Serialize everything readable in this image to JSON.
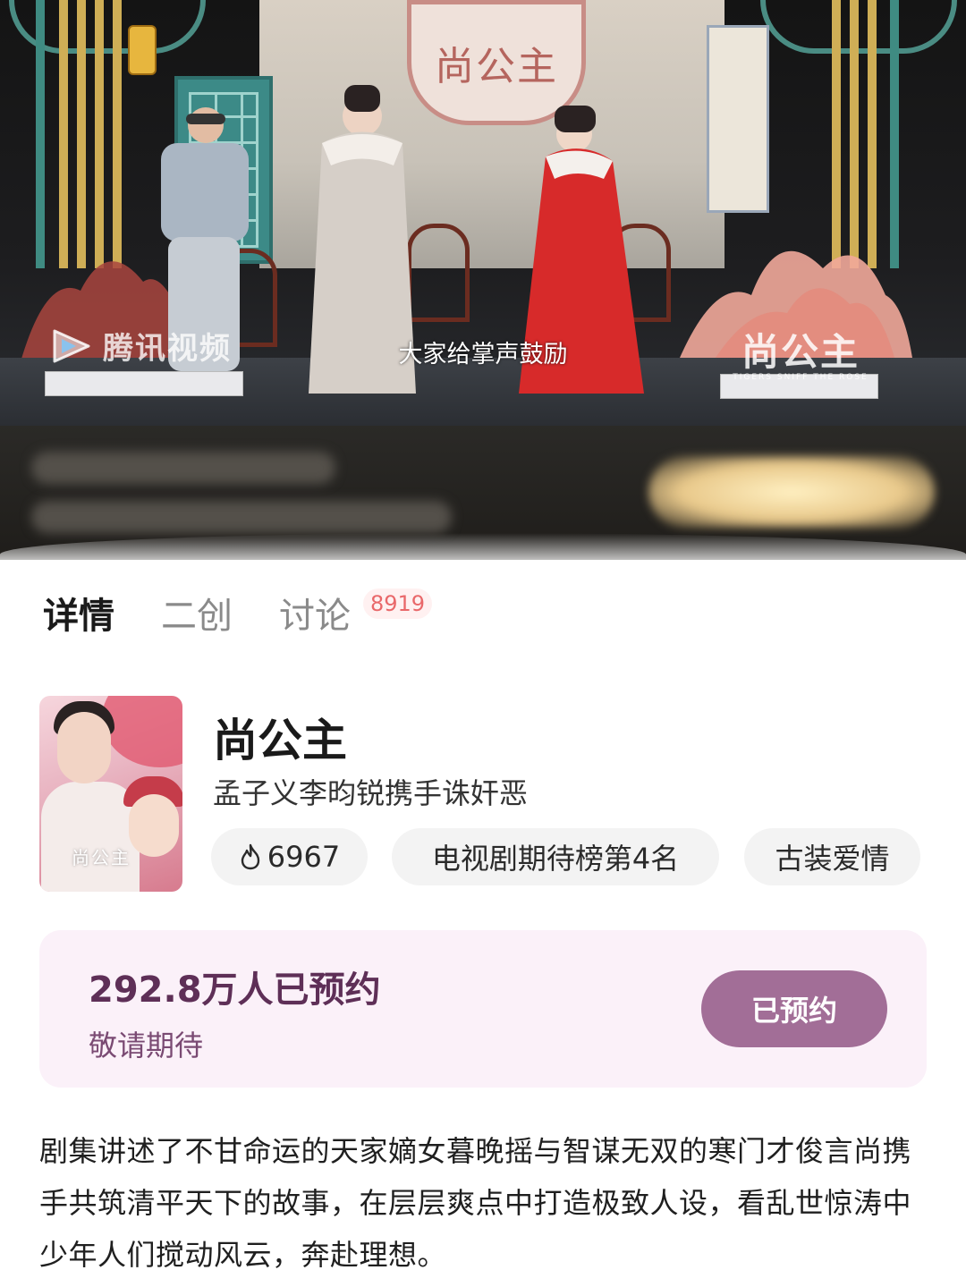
{
  "video": {
    "subtitle": "大家给掌声鼓励",
    "platform_watermark": "腾讯视频",
    "platform_logo_icon": "tencent-video-logo-icon",
    "show_watermark_title": "尚公主",
    "show_watermark_subtitle": "TIGERS SNIFF THE ROSE",
    "backdrop_sign": "尚公主"
  },
  "tabs": [
    {
      "label": "详情",
      "active": true
    },
    {
      "label": "二创",
      "active": false
    },
    {
      "label": "讨论",
      "active": false
    }
  ],
  "discussion_badge": "8919",
  "show": {
    "poster_title": "尚公主",
    "title": "尚公主",
    "tagline": "孟子义李昀锐携手诛奸恶",
    "heat_icon": "flame-icon",
    "heat": "6967",
    "ranking": "电视剧期待榜第4名",
    "genre": "古装爱情"
  },
  "reservation": {
    "count_text": "292.8万人已预约",
    "note": "敬请期待",
    "button_label": "已预约"
  },
  "synopsis": "剧集讲述了不甘命运的天家嫡女暮晚摇与智谋无双的寒门才俊言尚携手共筑清平天下的故事，在层层爽点中打造极致人设，看乱世惊涛中少年人们搅动风云，奔赴理想。",
  "colors": {
    "accent": "#a26e97",
    "card_bg": "#fbf1f9",
    "badge": "#e9686a"
  }
}
